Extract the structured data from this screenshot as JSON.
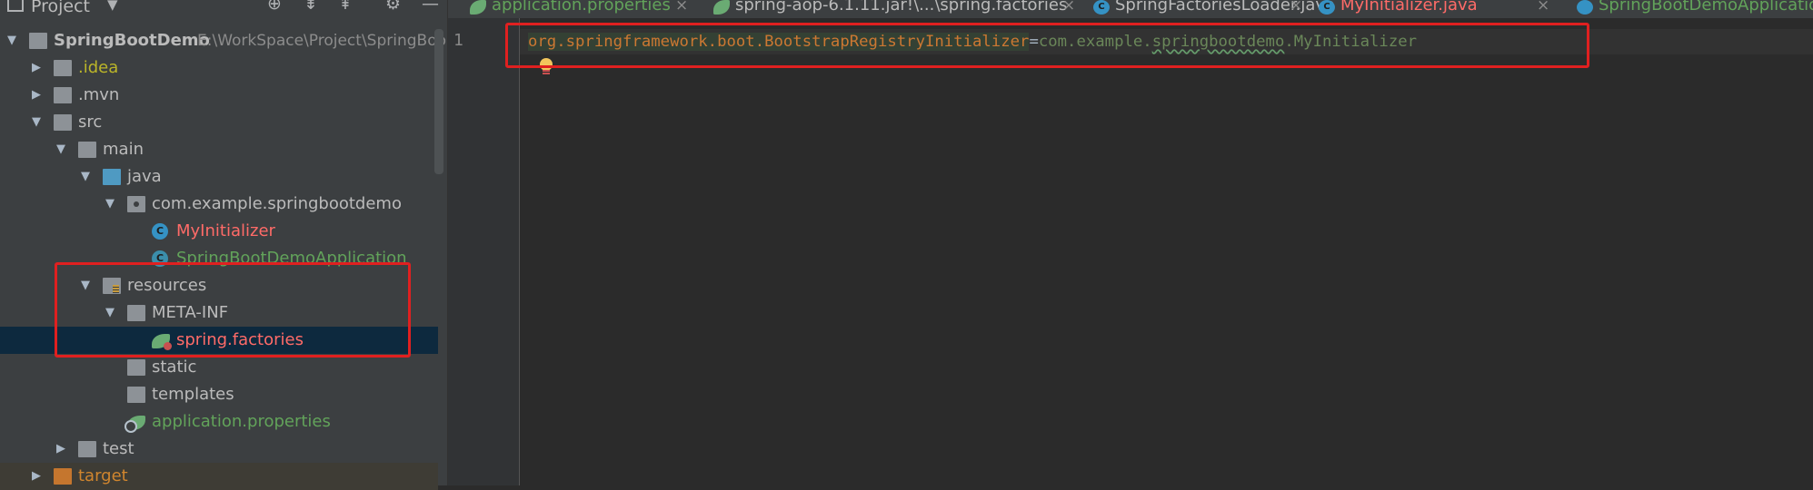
{
  "project_panel": {
    "title": "Project",
    "header_icons": [
      "chevron-down-icon",
      "locate-icon",
      "expand-all-icon",
      "collapse-all-icon",
      "gear-icon",
      "minimize-icon"
    ],
    "tree": [
      {
        "depth": 0,
        "arrow": "▼",
        "icon": "module-folder-icon",
        "label": "SpringBootDemo",
        "path": "E:\\WorkSpace\\Project\\SpringBoo",
        "color": "#bbbbbb"
      },
      {
        "depth": 1,
        "arrow": "▶",
        "icon": "folder-icon",
        "label": ".idea",
        "color": "#bbb529"
      },
      {
        "depth": 1,
        "arrow": "▶",
        "icon": "folder-icon",
        "label": ".mvn",
        "color": "#bbbbbb"
      },
      {
        "depth": 1,
        "arrow": "▼",
        "icon": "folder-icon",
        "label": "src",
        "color": "#bbbbbb"
      },
      {
        "depth": 2,
        "arrow": "▼",
        "icon": "folder-icon",
        "label": "main",
        "color": "#bbbbbb"
      },
      {
        "depth": 3,
        "arrow": "▼",
        "icon": "source-folder-icon",
        "label": "java",
        "color": "#bbbbbb"
      },
      {
        "depth": 4,
        "arrow": "▼",
        "icon": "package-icon",
        "label": "com.example.springbootdemo",
        "color": "#bbbbbb"
      },
      {
        "depth": 5,
        "arrow": "",
        "icon": "class-icon",
        "label": "MyInitializer",
        "color": "#ff6b68"
      },
      {
        "depth": 5,
        "arrow": "",
        "icon": "spring-boot-class-icon",
        "label": "SpringBootDemoApplication",
        "color": "#62a35a"
      },
      {
        "depth": 3,
        "arrow": "▼",
        "icon": "resources-folder-icon",
        "label": "resources",
        "color": "#bbbbbb"
      },
      {
        "depth": 4,
        "arrow": "▼",
        "icon": "folder-icon",
        "label": "META-INF",
        "color": "#bbbbbb"
      },
      {
        "depth": 5,
        "arrow": "",
        "icon": "spring-factories-icon",
        "label": "spring.factories",
        "color": "#ff6b68",
        "selected": true
      },
      {
        "depth": 4,
        "arrow": "",
        "icon": "folder-icon",
        "label": "static",
        "color": "#bbbbbb"
      },
      {
        "depth": 4,
        "arrow": "",
        "icon": "folder-icon",
        "label": "templates",
        "color": "#bbbbbb"
      },
      {
        "depth": 4,
        "arrow": "",
        "icon": "spring-properties-icon",
        "label": "application.properties",
        "color": "#62a35a"
      },
      {
        "depth": 2,
        "arrow": "▶",
        "icon": "folder-icon",
        "label": "test",
        "color": "#bbbbbb"
      },
      {
        "depth": 1,
        "arrow": "▶",
        "icon": "excluded-folder-icon",
        "label": "target",
        "color": "#d0852e",
        "excluded": true
      }
    ]
  },
  "tabs": [
    {
      "label": "application.properties",
      "icon": "spring-properties-icon",
      "color": "#62a35a",
      "close": "×"
    },
    {
      "label": "spring-aop-6.1.11.jar!\\...\\spring.factories",
      "icon": "spring-factories-icon",
      "color": "#bbbbbb",
      "close": "×"
    },
    {
      "label": "SpringFactoriesLoader.java",
      "icon": "class-icon",
      "color": "#bbbbbb",
      "close": "×"
    },
    {
      "label": "MyInitializer.java",
      "icon": "class-icon",
      "color": "#ff6b68",
      "close": "×"
    },
    {
      "label": "SpringBootDemoApplication",
      "icon": "spring-boot-class-icon",
      "color": "#62a35a",
      "close": ""
    }
  ],
  "editor": {
    "line_number": "1",
    "code": {
      "key": "org.springframework.boot.BootstrapRegistryInitializer",
      "eq": "=",
      "val_prefix": "com.example.",
      "val_typo": "springbootdemo",
      "val_suffix": ".MyInitializer"
    }
  },
  "colors": {
    "panel_bg": "#3c3f41",
    "editor_bg": "#2b2b2b",
    "selection": "#0d293e",
    "annotation_red": "#e02020",
    "property_key": "#cc7832",
    "property_value": "#6a8759"
  }
}
